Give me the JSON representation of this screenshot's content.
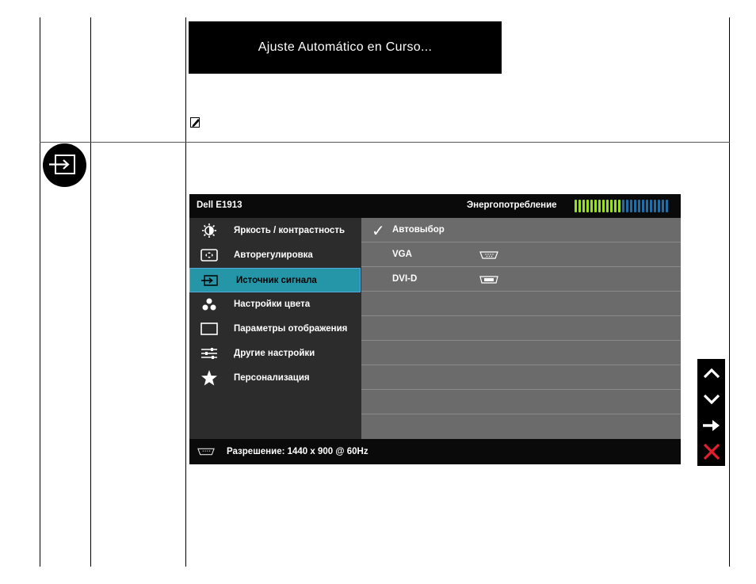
{
  "banner": {
    "text": "Ajuste Automático en Curso..."
  },
  "osd": {
    "model": "Dell E1913",
    "energy_label": "Энергопотребление",
    "energy_level": 0.5,
    "energy_colors": {
      "on": "#9be01e",
      "off": "#1e6ea8"
    },
    "menu": [
      {
        "label": "Яркость / контрастность",
        "icon": "brightness-icon"
      },
      {
        "label": "Авторегулировка",
        "icon": "auto-adjust-icon"
      },
      {
        "label": "Источник сигнала",
        "icon": "input-source-icon",
        "active": true
      },
      {
        "label": "Настройки цвета",
        "icon": "color-settings-icon"
      },
      {
        "label": "Параметры отображения",
        "icon": "display-settings-icon"
      },
      {
        "label": "Другие настройки",
        "icon": "other-settings-icon"
      },
      {
        "label": "Персонализация",
        "icon": "star-icon"
      }
    ],
    "options": [
      {
        "label": "Автовыбор",
        "checked": true
      },
      {
        "label": "VGA",
        "icon": "vga-connector-icon"
      },
      {
        "label": "DVI-D",
        "icon": "dvi-connector-icon"
      }
    ],
    "resolution": "Разрешение: 1440 x 900 @ 60Hz"
  },
  "nav_buttons": [
    {
      "icon": "up-arrow-icon"
    },
    {
      "icon": "down-arrow-icon"
    },
    {
      "icon": "right-arrow-icon"
    },
    {
      "icon": "close-icon",
      "color": "#e3202a"
    }
  ]
}
